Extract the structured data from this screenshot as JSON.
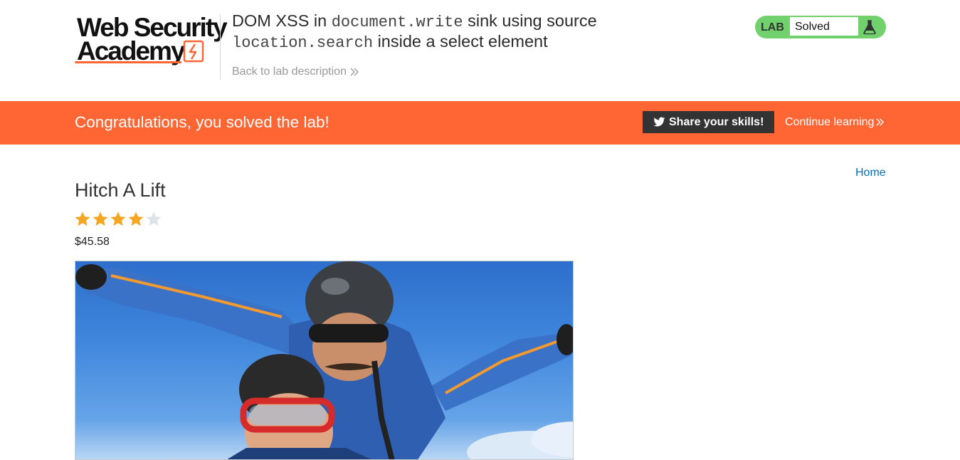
{
  "header": {
    "logo": {
      "line1": "Web Security",
      "line2": "Academy"
    },
    "lab_title": {
      "t1": "DOM XSS in ",
      "c1": "document.write",
      "t2": " sink using source ",
      "c2": "location.search",
      "t3": " inside a select element"
    },
    "back_link": "Back to lab description",
    "lab_badge": {
      "label": "LAB",
      "status": "Solved",
      "status_color": "#70d16d"
    }
  },
  "banner": {
    "message": "Congratulations, you solved the lab!",
    "share_label": "Share your skills!",
    "continue_label": "Continue learning",
    "background": "#ff6633"
  },
  "nav": {
    "home": "Home"
  },
  "product": {
    "name": "Hitch A Lift",
    "rating": 4,
    "rating_max": 5,
    "price": "$45.58",
    "image_alt_icon": "skydivers-photo"
  }
}
